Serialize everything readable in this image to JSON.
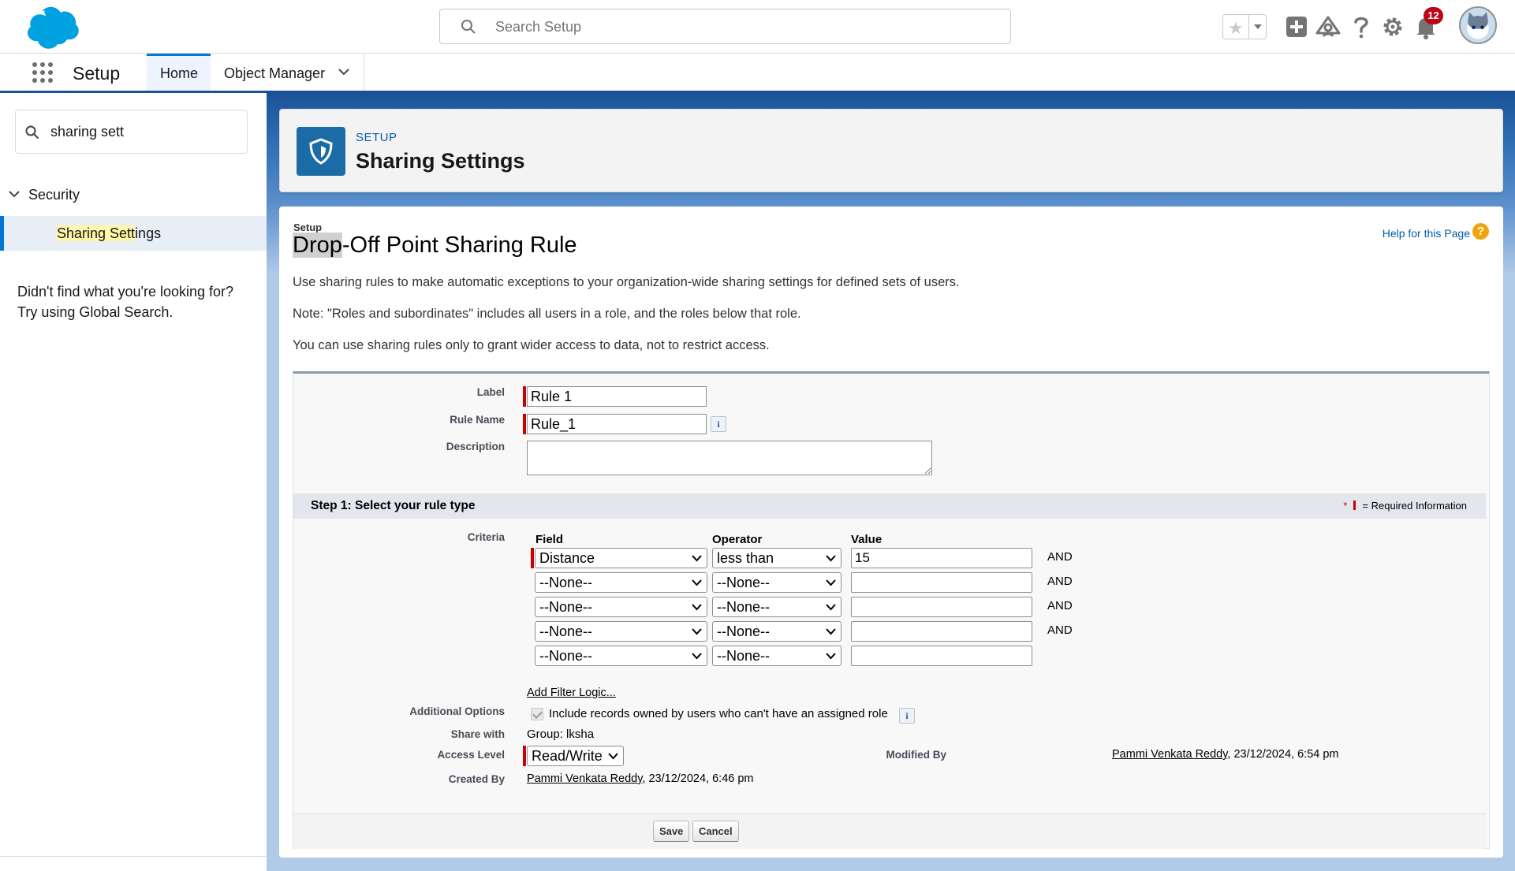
{
  "header": {
    "search_placeholder": "Search Setup",
    "notifications_count": "12"
  },
  "context_bar": {
    "app_name": "Setup",
    "tabs": [
      {
        "label": "Home"
      },
      {
        "label": "Object Manager"
      }
    ]
  },
  "sidebar": {
    "quick_find_value": "sharing sett",
    "tree_node": "Security",
    "tree_item_highlight": "Sharing Sett",
    "tree_item_rest": "ings",
    "not_found_line1": "Didn't find what you're looking for?",
    "not_found_line2": "Try using Global Search."
  },
  "page_header": {
    "eyebrow": "SETUP",
    "title": "Sharing Settings"
  },
  "content": {
    "breadcrumb": "Setup",
    "title_selected": "Drop",
    "title_rest": "-Off Point Sharing Rule",
    "help_link": "Help for this Page",
    "help_icon": "?",
    "para1": "Use sharing rules to make automatic exceptions to your organization-wide sharing settings for defined sets of users.",
    "para2": "Note: \"Roles and subordinates\" includes all users in a role, and the roles below that role.",
    "para3": "You can use sharing rules only to grant wider access to data, not to restrict access."
  },
  "form": {
    "label_label": "Label",
    "label_value": "Rule 1",
    "rule_name_label": "Rule Name",
    "rule_name_value": "Rule_1",
    "description_label": "Description",
    "description_value": "",
    "info_glyph": "i",
    "step1_title": "Step 1: Select your rule type",
    "required_star": "*",
    "required_info": "= Required Information",
    "criteria_label": "Criteria",
    "col_field": "Field",
    "col_operator": "Operator",
    "col_value": "Value",
    "criteria_rows": [
      {
        "field": "Distance",
        "operator": "less than",
        "value": "15",
        "conj": "AND"
      },
      {
        "field": "--None--",
        "operator": "--None--",
        "value": "",
        "conj": "AND"
      },
      {
        "field": "--None--",
        "operator": "--None--",
        "value": "",
        "conj": "AND"
      },
      {
        "field": "--None--",
        "operator": "--None--",
        "value": "",
        "conj": "AND"
      },
      {
        "field": "--None--",
        "operator": "--None--",
        "value": "",
        "conj": ""
      }
    ],
    "add_filter_logic": "Add Filter Logic...",
    "additional_options_label": "Additional Options",
    "additional_options_text": "Include records owned by users who can't have an assigned role",
    "additional_options_checked": true,
    "share_with_label": "Share with",
    "share_with_value": "Group: lksha",
    "access_level_label": "Access Level",
    "access_level_value": "Read/Write",
    "modified_by_label": "Modified By",
    "modified_by_name": "Pammi Venkata Reddy",
    "modified_by_date": ", 23/12/2024, 6:54 pm",
    "created_by_label": "Created By",
    "created_by_name": "Pammi Venkata Reddy",
    "created_by_date": ", 23/12/2024, 6:46 pm",
    "save_label": "Save",
    "cancel_label": "Cancel"
  },
  "colors": {
    "brand_blue": "#1b5297",
    "salesforce_cloud": "#00a1e0",
    "required_red": "#cc0000",
    "badge_red": "#ba0517",
    "link_blue": "#015ba7"
  }
}
